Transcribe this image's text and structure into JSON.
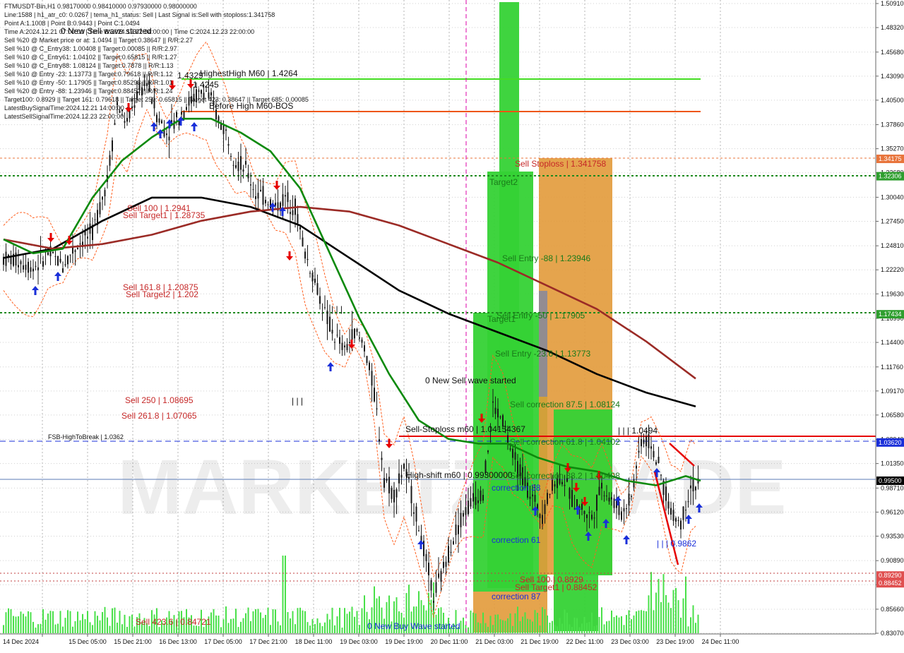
{
  "colors": {
    "background": "#ffffff",
    "grid": "#b4b4b4",
    "candle_up": "#1a1a1a",
    "candle_down": "#1a1a1a",
    "ma_black": "#000000",
    "ma_brown": "#9b2b26",
    "ma_green": "#0c8a0c",
    "band_orange": "#ff6020",
    "volume": "#49e049",
    "zone_green": "#35d235",
    "zone_orange": "#e29a3a",
    "red": "#e60000",
    "blue": "#1a2fd9",
    "label_red": "#c62828",
    "label_green": "#1a7a1a"
  },
  "header": {
    "lines": [
      "FTMUSDT-Bin,H1  0.98170000 0.98410000 0.97930000 0.98000000",
      "Line:1588 | h1_atr_c0: 0.0267 | tema_h1_status: Sell | Last Signal is:Sell with stoploss:1.341758",
      "Point A:1.1008 | Point B:0.9443 | Point C:1.0494",
      "Time A:2024.12.21 07:00:00 | Time B:2024.12.22 04:00:00 | Time C:2024.12.23 22:00:00",
      "Sell %20 @ Market price or at: 1.0494 || Target:0.38647 || R/R:2.27",
      "Sell %10 @ C_Entry38: 1.00408 || Target:0.00085 || R/R:2.97",
      "Sell %10 @ C_Entry61: 1.04102 || Target:0.65815 || R/R:1.27",
      "Sell %10 @ C_Entry88: 1.08124 || Target:0.7878 || R/R:1.13",
      "Sell %10 @ Entry -23: 1.13773 || Target:0.79618 || R/R:1.12",
      "Sell %10 @ Entry -50: 1.17905 || Target:0.85298 || R/R:1.01",
      "Sell %20 @ Entry -88: 1.23946 || Target:0.88452 || R/R:1.24",
      "Target100: 0.8929 || Target 161: 0.79618 || Target 250: 0.65815 || Target 423: 0.38647 || Target 685: 0.00085",
      "LatestBuySignalTime:2024.12.21 14:00:00",
      "LatestSellSignalTime:2024.12.23 22:00:00"
    ]
  },
  "annotations": {
    "highest_high": "HighestHigh   M60 | 1.4264",
    "before_high": "Before High   M60-BOS",
    "high_label": "1.4329",
    "high_label2": "1.4245",
    "sell_stoploss": "Sell Stoploss | 1.341758",
    "target2": "Target2",
    "target1": "Target1",
    "sell_100": "Sell 100 | 1.2941",
    "sell_target1_upper": "Sell Target1 | 1.28735",
    "sell_entry_88": "Sell Entry -88 | 1.23946",
    "sell_161": "Sell 161.8 | 1.20875",
    "sell_target2": "Sell Target2 | 1.202",
    "sell_entry_50": "Sell Entry -50 | 1.17905",
    "sell_entry_23": "Sell Entry -23.6 | 1.13773",
    "new_sell_wave": "0 New Sell wave started",
    "new_sell_wave_top": "0 New Sell wave started",
    "sell_correction_875": "Sell correction 87.5 | 1.08124",
    "sell_250": "Sell  250 | 1.08695",
    "sell_2618": "Sell  261.8 | 1.07065",
    "sell_stoploss_m60": "Sell-Stoploss m60 | 1.04154367",
    "level_10494": "| | | 1.0494",
    "fsb": "FSB-HighToBreak | 1.0362",
    "sell_correction_618": "Sell correction 61.8 | 1.04102",
    "high_shift": "High-shift m60 | 0.99300000",
    "sell_correction_382": "Sell correction 38.2 | 1.00408",
    "correction_38": "correction 38",
    "correction_61": "correction 61",
    "correction_87": "correction 87",
    "level_09862": "| | | 0.9862",
    "sell_100_lower": "Sell 100 | 0.8929",
    "sell_target1_lower": "Sell Target1 | 0.88452",
    "sell_4236": "Sell  423.6 | 0.84721",
    "new_buy_wave": "0 New Buy Wave started",
    "ticks_111a": "| | |",
    "ticks_111b": "| | |"
  },
  "price_axis": {
    "ticks": [
      "1.50910",
      "1.48320",
      "1.45680",
      "1.43090",
      "1.40500",
      "1.37860",
      "1.35270",
      "1.32680",
      "1.30040",
      "1.27450",
      "1.24810",
      "1.22220",
      "1.19630",
      "1.16990",
      "1.14400",
      "1.11760",
      "1.09170",
      "1.06580",
      "1.03940",
      "1.01350",
      "0.98710",
      "0.96120",
      "0.93530",
      "0.90890",
      "0.88300",
      "0.85660",
      "0.83070"
    ],
    "markers": [
      {
        "label": "1.34175",
        "price": 1.34175,
        "color": "#e8743b"
      },
      {
        "label": "1.32306",
        "price": 1.32306,
        "color": "#2e9e2e"
      },
      {
        "label": "1.17434",
        "price": 1.17434,
        "color": "#2e9e2e"
      },
      {
        "label": "1.03620",
        "price": 1.0362,
        "color": "#1a2fd9"
      },
      {
        "label": "0.99500",
        "price": 0.995,
        "color": "#000000"
      },
      {
        "label": "0.89290",
        "price": 0.8929,
        "color": "#e05050"
      },
      {
        "label": "0.88452",
        "price": 0.88452,
        "color": "#e05050"
      }
    ]
  },
  "time_axis": {
    "labels": [
      "14 Dec 2024",
      "15 Dec 05:00",
      "15 Dec 21:00",
      "16 Dec 13:00",
      "17 Dec 05:00",
      "17 Dec 21:00",
      "18 Dec 11:00",
      "19 Dec 03:00",
      "19 Dec 19:00",
      "20 Dec 11:00",
      "21 Dec 03:00",
      "21 Dec 19:00",
      "22 Dec 11:00",
      "23 Dec 03:00",
      "23 Dec 19:00",
      "24 Dec 11:00"
    ]
  },
  "watermark": "MARKETZITRADE",
  "chart_data": {
    "type": "candlestick",
    "symbol": "FTMUSDT-Bin",
    "timeframe": "H1",
    "ylim": [
      0.8307,
      1.5091
    ],
    "x_labels": [
      "14 Dec 2024",
      "15 Dec 05:00",
      "15 Dec 21:00",
      "16 Dec 13:00",
      "17 Dec 05:00",
      "17 Dec 21:00",
      "18 Dec 11:00",
      "19 Dec 03:00",
      "19 Dec 19:00",
      "20 Dec 11:00",
      "21 Dec 03:00",
      "21 Dec 19:00",
      "22 Dec 11:00",
      "23 Dec 03:00",
      "23 Dec 19:00",
      "24 Dec 11:00"
    ],
    "price_path": [
      [
        0,
        1.235
      ],
      [
        3,
        1.232
      ],
      [
        6,
        1.225
      ],
      [
        9,
        1.24
      ],
      [
        12,
        1.228
      ],
      [
        15,
        1.25
      ],
      [
        18,
        1.262
      ],
      [
        21,
        1.32
      ],
      [
        23,
        1.4
      ],
      [
        25,
        1.38
      ],
      [
        27,
        1.41
      ],
      [
        29,
        1.425
      ],
      [
        31,
        1.39
      ],
      [
        33,
        1.37
      ],
      [
        35,
        1.385
      ],
      [
        37,
        1.4
      ],
      [
        39,
        1.41
      ],
      [
        41,
        1.415
      ],
      [
        43,
        1.39
      ],
      [
        45,
        1.37
      ],
      [
        47,
        1.34
      ],
      [
        49,
        1.33
      ],
      [
        51,
        1.305
      ],
      [
        53,
        1.3
      ],
      [
        55,
        1.29
      ],
      [
        57,
        1.3
      ],
      [
        59,
        1.29
      ],
      [
        61,
        1.24
      ],
      [
        63,
        1.21
      ],
      [
        65,
        1.175
      ],
      [
        67,
        1.15
      ],
      [
        69,
        1.135
      ],
      [
        71,
        1.155
      ],
      [
        73,
        1.14
      ],
      [
        75,
        1.09
      ],
      [
        77,
        1.0
      ],
      [
        79,
        0.98
      ],
      [
        81,
        1.01
      ],
      [
        83,
        0.97
      ],
      [
        85,
        0.92
      ],
      [
        87,
        0.87
      ],
      [
        89,
        0.9
      ],
      [
        91,
        0.935
      ],
      [
        93,
        0.96
      ],
      [
        95,
        0.975
      ],
      [
        97,
        0.985
      ],
      [
        99,
        1.075
      ],
      [
        101,
        1.06
      ],
      [
        103,
        1.02
      ],
      [
        105,
        1.0
      ],
      [
        107,
        0.975
      ],
      [
        109,
        0.96
      ],
      [
        111,
        0.99
      ],
      [
        113,
        1.0
      ],
      [
        115,
        0.975
      ],
      [
        117,
        0.965
      ],
      [
        119,
        0.955
      ],
      [
        121,
        0.99
      ],
      [
        123,
        0.975
      ],
      [
        125,
        0.96
      ],
      [
        127,
        0.98
      ],
      [
        129,
        1.04
      ],
      [
        131,
        1.035
      ],
      [
        133,
        1.0
      ],
      [
        135,
        0.96
      ],
      [
        137,
        0.95
      ],
      [
        139,
        0.99
      ],
      [
        141,
        0.99
      ]
    ],
    "moving_averages": [
      {
        "name": "MA black",
        "color": "#000000",
        "points": [
          [
            0,
            1.235
          ],
          [
            10,
            1.245
          ],
          [
            20,
            1.275
          ],
          [
            30,
            1.3
          ],
          [
            40,
            1.3
          ],
          [
            50,
            1.29
          ],
          [
            60,
            1.27
          ],
          [
            70,
            1.235
          ],
          [
            80,
            1.2
          ],
          [
            90,
            1.175
          ],
          [
            100,
            1.155
          ],
          [
            110,
            1.135
          ],
          [
            120,
            1.11
          ],
          [
            130,
            1.09
          ],
          [
            140,
            1.075
          ]
        ]
      },
      {
        "name": "MA brown",
        "color": "#9b2b26",
        "points": [
          [
            0,
            1.255
          ],
          [
            10,
            1.245
          ],
          [
            20,
            1.25
          ],
          [
            30,
            1.26
          ],
          [
            40,
            1.275
          ],
          [
            50,
            1.285
          ],
          [
            60,
            1.29
          ],
          [
            70,
            1.285
          ],
          [
            80,
            1.27
          ],
          [
            90,
            1.25
          ],
          [
            100,
            1.23
          ],
          [
            110,
            1.205
          ],
          [
            120,
            1.18
          ],
          [
            130,
            1.145
          ],
          [
            140,
            1.105
          ]
        ]
      },
      {
        "name": "MA green",
        "color": "#0c8a0c",
        "points": [
          [
            0,
            1.255
          ],
          [
            6,
            1.24
          ],
          [
            12,
            1.245
          ],
          [
            18,
            1.3
          ],
          [
            24,
            1.34
          ],
          [
            30,
            1.365
          ],
          [
            36,
            1.385
          ],
          [
            42,
            1.385
          ],
          [
            48,
            1.37
          ],
          [
            54,
            1.35
          ],
          [
            60,
            1.31
          ],
          [
            66,
            1.24
          ],
          [
            72,
            1.17
          ],
          [
            78,
            1.11
          ],
          [
            84,
            1.06
          ],
          [
            90,
            1.04
          ],
          [
            96,
            1.035
          ],
          [
            102,
            1.035
          ],
          [
            108,
            1.02
          ],
          [
            114,
            1.01
          ],
          [
            120,
            1.005
          ],
          [
            126,
            0.995
          ],
          [
            132,
            0.99
          ],
          [
            138,
            1.0
          ],
          [
            141,
            0.995
          ]
        ]
      }
    ],
    "levels": [
      {
        "name": "HighestHigh M60",
        "price": 1.4264
      },
      {
        "name": "Before High M60-BOS",
        "price": 1.3938
      },
      {
        "name": "Sell Stoploss",
        "price": 1.341758
      },
      {
        "name": "Target2",
        "price": 1.32306
      },
      {
        "name": "Target1",
        "price": 1.17434
      },
      {
        "name": "Sell-Stoploss m60",
        "price": 1.04154367
      },
      {
        "name": "FSB-HighToBreak",
        "price": 1.0362
      },
      {
        "name": "Current",
        "price": 0.995
      },
      {
        "name": "Sell 100",
        "price": 0.8929
      },
      {
        "name": "Sell Target1",
        "price": 0.88452
      }
    ]
  }
}
